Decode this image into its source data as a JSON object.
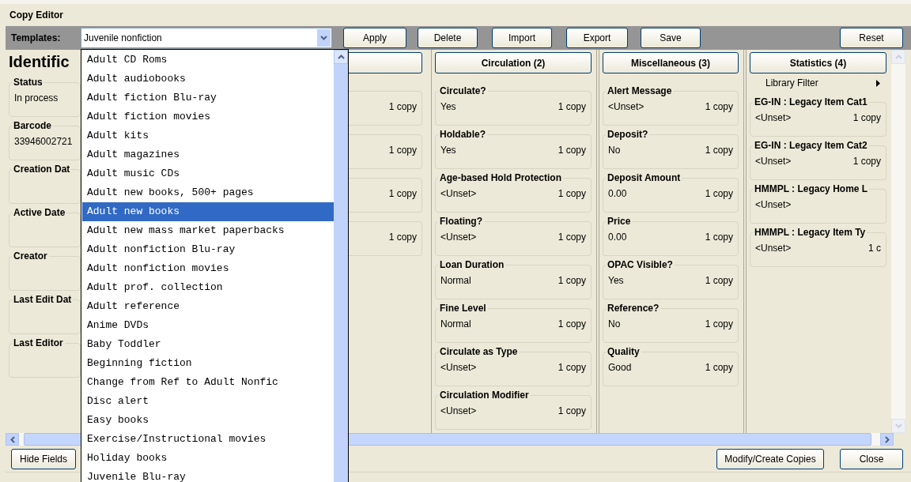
{
  "window": {
    "title": "Copy Editor"
  },
  "toolbar": {
    "label": "Templates:",
    "template_select": {
      "value": "Juvenile nonfiction",
      "expanded": true
    },
    "buttons": [
      {
        "label": "Apply"
      },
      {
        "label": "Delete"
      },
      {
        "label": "Import"
      },
      {
        "label": "Export"
      },
      {
        "label": "Save"
      },
      {
        "label": "Reset"
      }
    ]
  },
  "template_options": [
    {
      "label": "Adult CD Roms",
      "selected": false
    },
    {
      "label": "Adult audiobooks",
      "selected": false
    },
    {
      "label": "Adult fiction Blu-ray",
      "selected": false
    },
    {
      "label": "Adult fiction movies",
      "selected": false
    },
    {
      "label": "Adult kits",
      "selected": false
    },
    {
      "label": "Adult magazines",
      "selected": false
    },
    {
      "label": "Adult music CDs",
      "selected": false
    },
    {
      "label": "Adult new books, 500+ pages",
      "selected": false
    },
    {
      "label": "Adult new books",
      "selected": true
    },
    {
      "label": "Adult new mass market paperbacks",
      "selected": false
    },
    {
      "label": "Adult nonfiction Blu-ray",
      "selected": false
    },
    {
      "label": "Adult nonfiction movies",
      "selected": false
    },
    {
      "label": "Adult prof. collection",
      "selected": false
    },
    {
      "label": "Adult reference",
      "selected": false
    },
    {
      "label": "Anime DVDs",
      "selected": false
    },
    {
      "label": "Baby Toddler",
      "selected": false
    },
    {
      "label": "Beginning fiction",
      "selected": false
    },
    {
      "label": "Change from Ref to Adult Nonfic",
      "selected": false
    },
    {
      "label": "Disc alert",
      "selected": false
    },
    {
      "label": "Easy books",
      "selected": false
    },
    {
      "label": "Exercise/Instructional movies",
      "selected": false
    },
    {
      "label": "Holiday books",
      "selected": false
    },
    {
      "label": "Juvenile Blu-ray",
      "selected": false
    }
  ],
  "identification": {
    "heading": "Identific",
    "fields": [
      {
        "label": "Status",
        "value": "In process"
      },
      {
        "label": "Barcode",
        "value": "33946002721"
      },
      {
        "label": "Creation Dat"
      },
      {
        "label": "Active Date"
      },
      {
        "label": "Creator"
      },
      {
        "label": "Last Edit Dat"
      },
      {
        "label": "Last Editor"
      }
    ]
  },
  "covered_column": {
    "fields": [
      {
        "count": "1 copy"
      },
      {
        "count": "1 copy"
      },
      {
        "count": "1 copy"
      },
      {
        "count": "1 copy"
      }
    ]
  },
  "columns": [
    {
      "title": "Circulation (2)",
      "fields": [
        {
          "label": "Circulate?",
          "value": "Yes",
          "count": "1 copy"
        },
        {
          "label": "Holdable?",
          "value": "Yes",
          "count": "1 copy"
        },
        {
          "label": "Age-based Hold Protection",
          "value": "<Unset>",
          "count": "1 copy"
        },
        {
          "label": "Floating?",
          "value": "<Unset>",
          "count": "1 copy"
        },
        {
          "label": "Loan Duration",
          "value": "Normal",
          "count": "1 copy"
        },
        {
          "label": "Fine Level",
          "value": "Normal",
          "count": "1 copy"
        },
        {
          "label": "Circulate as Type",
          "value": "<Unset>",
          "count": "1 copy"
        },
        {
          "label": "Circulation Modifier",
          "value": "<Unset>",
          "count": "1 copy"
        }
      ]
    },
    {
      "title": "Miscellaneous (3)",
      "fields": [
        {
          "label": "Alert Message",
          "value": "<Unset>",
          "count": "1 copy"
        },
        {
          "label": "Deposit?",
          "value": "No",
          "count": "1 copy"
        },
        {
          "label": "Deposit Amount",
          "value": "0.00",
          "count": "1 copy"
        },
        {
          "label": "Price",
          "value": "0.00",
          "count": "1 copy"
        },
        {
          "label": "OPAC Visible?",
          "value": "Yes",
          "count": "1 copy"
        },
        {
          "label": "Reference?",
          "value": "No",
          "count": "1 copy"
        },
        {
          "label": "Quality",
          "value": "Good",
          "count": "1 copy"
        }
      ]
    },
    {
      "title": "Statistics (4)",
      "filter": "Library Filter",
      "fields": [
        {
          "label": "EG-IN : Legacy Item Cat1",
          "value": "<Unset>",
          "count": "1 copy"
        },
        {
          "label": "EG-IN : Legacy Item Cat2",
          "value": "<Unset>",
          "count": "1 copy"
        },
        {
          "label": "HMMPL : Legacy Home L",
          "value": "<Unset>"
        },
        {
          "label": "HMMPL : Legacy Item Ty",
          "value": "<Unset>",
          "count": "1 c"
        }
      ]
    }
  ],
  "bottom": {
    "left_button": "Hide Fields",
    "right_buttons": [
      "Modify/Create Copies",
      "Close"
    ]
  }
}
